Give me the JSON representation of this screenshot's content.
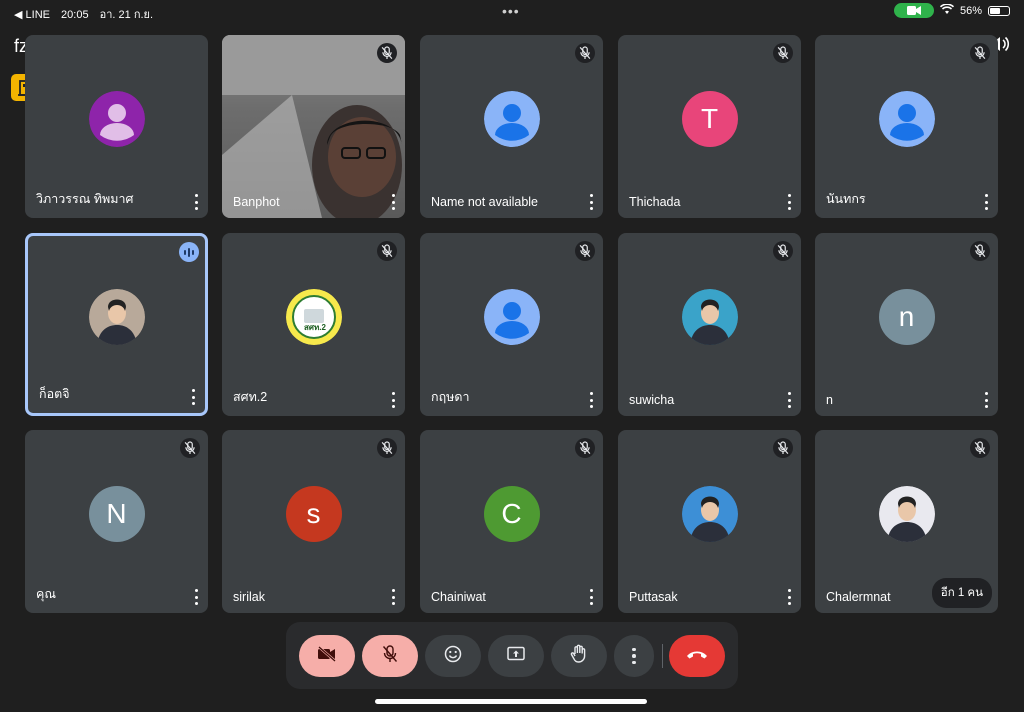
{
  "status_bar": {
    "back_app": "◀ LINE",
    "time": "20:05",
    "date": "อา. 21 ก.ย.",
    "battery": "56%",
    "battery_level": 0.56
  },
  "meeting": {
    "code": "fzf-jmtb-zjo"
  },
  "participants": [
    {
      "name": "วิภาวรรณ ทิพมาศ",
      "avatar_type": "person",
      "avatar_color": "#8e24aa",
      "muted": false
    },
    {
      "name": "Banphot",
      "avatar_type": "video",
      "muted": true
    },
    {
      "name": "Name not available",
      "avatar_type": "person",
      "avatar_color": "#8ab4f8",
      "muted": true
    },
    {
      "name": "Thichada",
      "avatar_type": "letter",
      "letter": "T",
      "avatar_color": "#e8457a",
      "muted": true
    },
    {
      "name": "นันทกร",
      "avatar_type": "person",
      "avatar_color": "#8ab4f8",
      "muted": true
    },
    {
      "name": "ก็อตจิ",
      "avatar_type": "photo",
      "avatar_color": "#b8a99a",
      "muted": false,
      "speaking": true
    },
    {
      "name": "สศท.2",
      "avatar_type": "logo",
      "avatar_color": "#f7e94c",
      "muted": true
    },
    {
      "name": "กฤษดา",
      "avatar_type": "person",
      "avatar_color": "#8ab4f8",
      "muted": true
    },
    {
      "name": "suwicha",
      "avatar_type": "photo",
      "avatar_color": "#3aa3c9",
      "muted": true
    },
    {
      "name": "n",
      "avatar_type": "letter",
      "letter": "n",
      "avatar_color": "#78909c",
      "muted": true
    },
    {
      "name": "คุณ",
      "avatar_type": "letter",
      "letter": "N",
      "avatar_color": "#78909c",
      "muted": true
    },
    {
      "name": "sirilak",
      "avatar_type": "letter",
      "letter": "s",
      "avatar_color": "#c5381f",
      "muted": true
    },
    {
      "name": "Chainiwat",
      "avatar_type": "letter",
      "letter": "C",
      "avatar_color": "#4e9a32",
      "muted": true
    },
    {
      "name": "Puttasak",
      "avatar_type": "photo",
      "avatar_color": "#3d8fd6",
      "muted": true
    },
    {
      "name": "Chalermnat",
      "avatar_type": "photo",
      "avatar_color": "#e9e9ef",
      "muted": true
    }
  ],
  "more_participants_label": "อีก 1 คน",
  "icons": {
    "logo_letter": "2",
    "logo_text": "สศท.2"
  },
  "colors": {
    "tile_bg": "#3c4043",
    "cam_off_btn": "#f6aea9",
    "mic_off_btn": "#f6aea9",
    "end_call_btn": "#e53935",
    "neutral_btn": "#3c4043",
    "speaking_border": "#a8c7fa"
  }
}
